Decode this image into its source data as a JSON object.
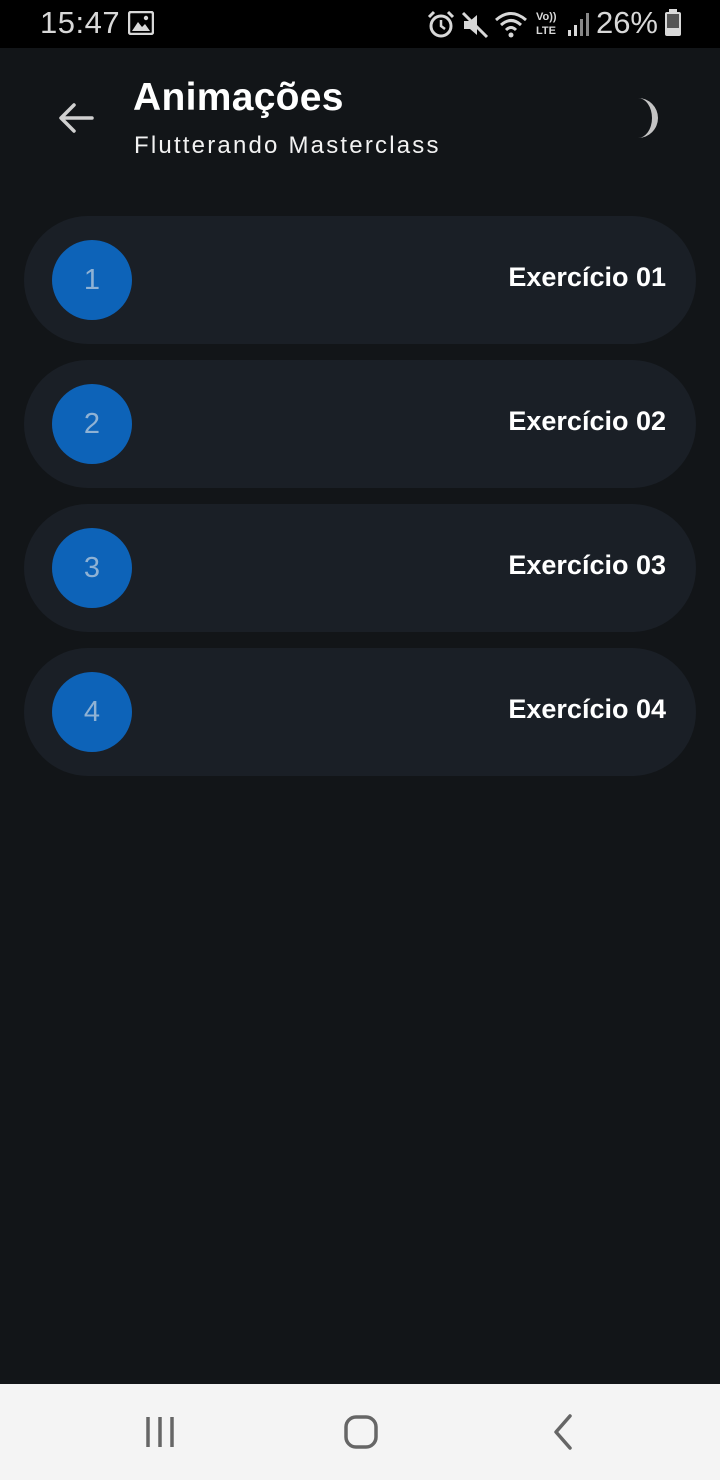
{
  "status_bar": {
    "time": "15:47",
    "battery": "26%",
    "icons": [
      "gallery-icon",
      "alarm-icon",
      "mute-icon",
      "wifi-icon",
      "volte-icon",
      "signal-icon",
      "battery-icon"
    ]
  },
  "app_bar": {
    "title": "Animações",
    "subtitle": "Flutterando Masterclass",
    "back_icon": "arrow-left-icon",
    "theme_icon": "moon-icon"
  },
  "exercises": [
    {
      "number": "1",
      "label": "Exercício 01"
    },
    {
      "number": "2",
      "label": "Exercício 02"
    },
    {
      "number": "3",
      "label": "Exercício 03"
    },
    {
      "number": "4",
      "label": "Exercício 04"
    }
  ],
  "nav_bar": {
    "icons": [
      "recents-icon",
      "home-icon",
      "back-icon"
    ]
  },
  "colors": {
    "background": "#121518",
    "card": "#1a1f26",
    "accent": "#0d63b8"
  }
}
